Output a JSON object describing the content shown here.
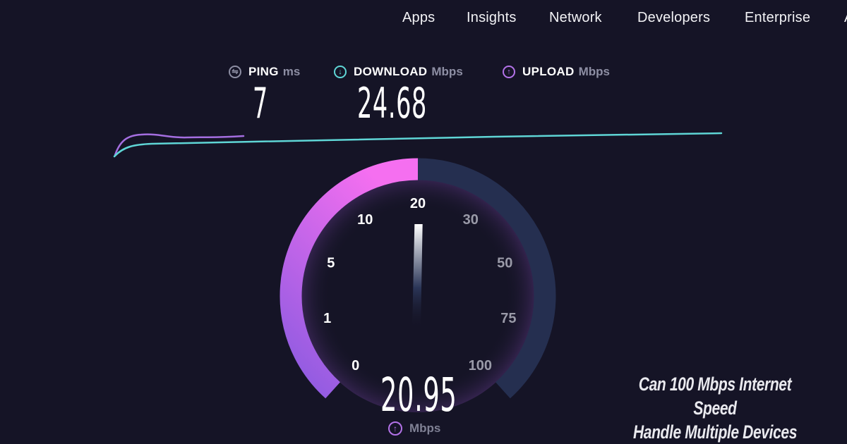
{
  "nav": {
    "items": [
      {
        "label": "Apps"
      },
      {
        "label": "Insights"
      },
      {
        "label": "Network"
      },
      {
        "label": "Developers"
      },
      {
        "label": "Enterprise"
      },
      {
        "label": "A"
      }
    ]
  },
  "metrics": {
    "ping": {
      "icon": "ping-icon",
      "glyph": "⇋",
      "label": "PING",
      "unit": "ms",
      "value": "7",
      "color": "#8d8ea3"
    },
    "download": {
      "icon": "download-arrow-icon",
      "glyph": "↓",
      "label": "DOWNLOAD",
      "unit": "Mbps",
      "value": "24.68",
      "color": "#5fd6d6"
    },
    "upload": {
      "icon": "upload-arrow-icon",
      "glyph": "↑",
      "label": "UPLOAD",
      "unit": "Mbps",
      "value": "",
      "color": "#b372e8"
    }
  },
  "gauge": {
    "current_value": "20.95",
    "current_numeric": 20.95,
    "unit": "Mbps",
    "unit_icon_glyph": "↑",
    "ticks": [
      "0",
      "1",
      "5",
      "10",
      "20",
      "30",
      "50",
      "75",
      "100"
    ],
    "progress_fraction": 0.5,
    "colors": {
      "arc_start": "#8a5ae0",
      "arc_end": "#f56ff0",
      "track": "#252f50",
      "tick_active": "#ffffff",
      "tick_inactive": "#9a9aa8"
    }
  },
  "graph": {
    "download_color": "#5fd6d6",
    "upload_color": "#a46ee0"
  },
  "headline": {
    "line1": "Can 100 Mbps Internet Speed",
    "line2": "Handle Multiple Devices"
  }
}
